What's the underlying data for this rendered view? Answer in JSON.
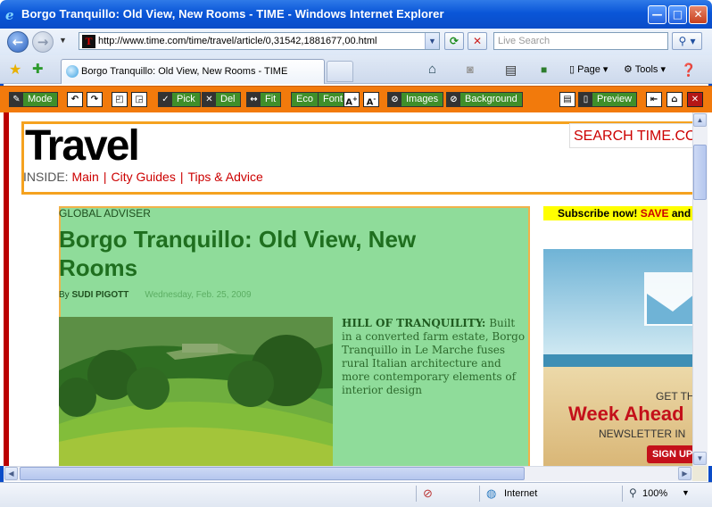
{
  "window": {
    "title": "Borgo Tranquillo: Old View, New Rooms - TIME - Windows Internet Explorer",
    "minimize_glyph": "—",
    "maximize_glyph": "□",
    "close_glyph": "✕"
  },
  "address": {
    "url": "http://www.time.com/time/travel/article/0,31542,1881677,00.html",
    "search_placeholder": "Live Search"
  },
  "tab": {
    "title": "Borgo Tranquillo: Old View, New Rooms - TIME"
  },
  "commands": {
    "page": "Page",
    "tools": "Tools"
  },
  "printtool": {
    "mode": "Mode",
    "pick": "Pick",
    "del": "Del",
    "fit": "Fit",
    "eco": "Eco",
    "font": "Font",
    "images": "Images",
    "background": "Background",
    "preview": "Preview"
  },
  "page": {
    "logo": "Travel",
    "inside_label": "INSIDE:",
    "nav": [
      "Main",
      "City Guides",
      "Tips & Advice"
    ],
    "search": "SEARCH TIME.COM",
    "kicker": "GLOBAL ADVISER",
    "headline": "Borgo Tranquillo: Old View, New Rooms",
    "byline_prefix": "By",
    "author": "SUDI PIGOTT",
    "date": "Wednesday, Feb. 25, 2009",
    "caption_lead": "HILL OF TRANQUILITY:",
    "caption_body": " Built in a converted farm estate, Borgo Tranquillo in Le Marche fuses rural Italian architecture and more contemporary elements of interior design",
    "subscribe_pre": "Subscribe now! ",
    "subscribe_save": "SAVE",
    "subscribe_post": " and m",
    "ad_line1": "GET TH",
    "ad_line2": "Week Ahead",
    "ad_line3": "NEWSLETTER IN",
    "ad_signup": "SIGN UP"
  },
  "status": {
    "zone": "Internet",
    "zoom": "100%"
  },
  "colors": {
    "toolbar_orange": "#f27a0c",
    "article_bg": "#8fdc9a",
    "headline_green": "#1f6f1f",
    "link_red": "#cc0000"
  }
}
